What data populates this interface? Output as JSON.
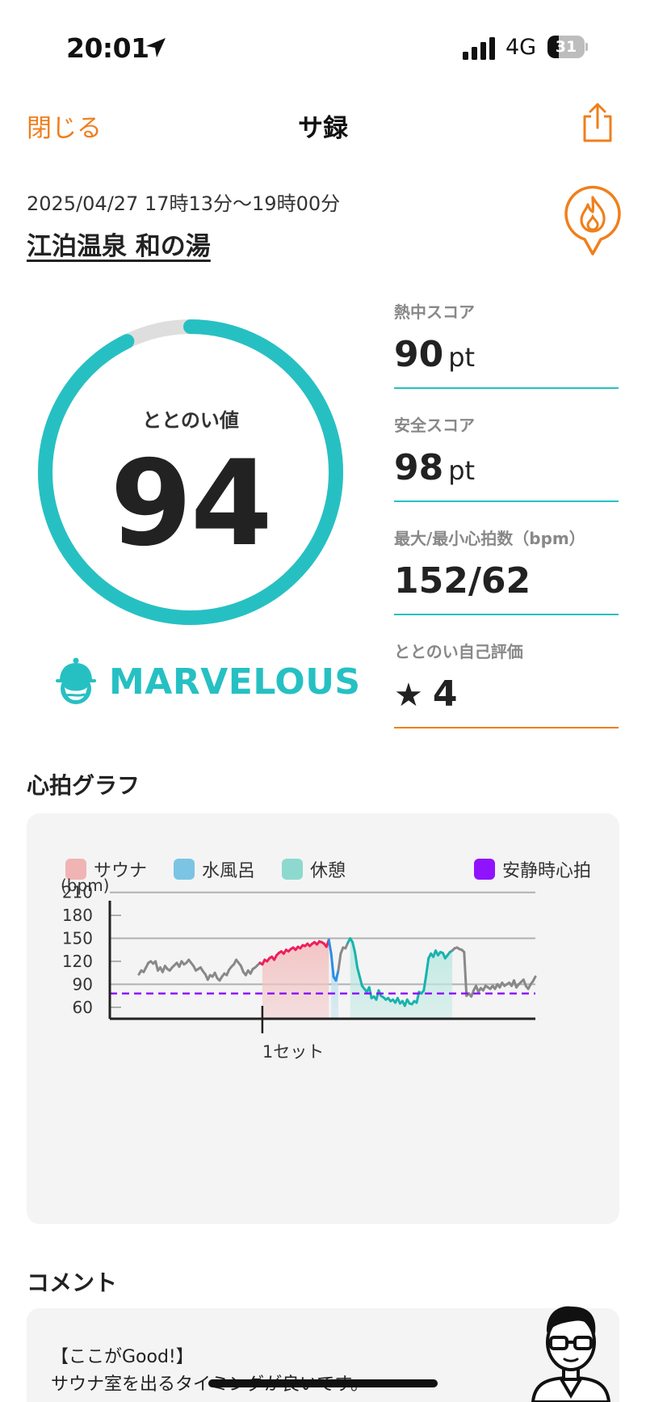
{
  "status": {
    "time": "20:01",
    "network": "4G",
    "battery": "31",
    "battery_level": 0.31
  },
  "nav": {
    "close_label": "閉じる",
    "title": "サ録"
  },
  "session": {
    "datetime": "2025/04/27 17時13分〜19時00分",
    "facility": "江泊温泉 和の湯"
  },
  "totonoi": {
    "label": "ととのい値",
    "value": "94",
    "fraction": 0.94,
    "rank": "MARVELOUS"
  },
  "stats": [
    {
      "label": "熱中スコア",
      "value": "90",
      "unit": "pt"
    },
    {
      "label": "安全スコア",
      "value": "98",
      "unit": "pt"
    },
    {
      "label": "最大/最小心拍数（bpm）",
      "value": "152/62",
      "unit": ""
    },
    {
      "label": "ととのい自己評価",
      "value": "4",
      "unit": ""
    }
  ],
  "heart_section": {
    "title": "心拍グラフ"
  },
  "chart_data": {
    "type": "line",
    "title": "",
    "xlabel": "",
    "ylabel": "(bpm)",
    "yticks": [
      210,
      180,
      150,
      120,
      90,
      60
    ],
    "ylim": [
      45,
      215
    ],
    "x_marker_label": "1セット",
    "legend": [
      {
        "name": "サウナ",
        "color": "#f0b4b4"
      },
      {
        "name": "水風呂",
        "color": "#7cc4e4"
      },
      {
        "name": "休憩",
        "color": "#8ed9cf"
      },
      {
        "name": "安静時心拍",
        "color": "#9013fe"
      }
    ],
    "resting_hr": 78,
    "colors": {
      "normal": "#888888",
      "sauna": "#ee1f5c",
      "cold": "#2a8ee6",
      "rest": "#18b3ad"
    },
    "series": [
      {
        "values": [
          103,
          108,
          106,
          112,
          118,
          120,
          117,
          120,
          108,
          112,
          106,
          114,
          110,
          108,
          112,
          115,
          118,
          113,
          120,
          116,
          118,
          122,
          118,
          114,
          108,
          110,
          112,
          107,
          103,
          96,
          102,
          100,
          105,
          98,
          95,
          100,
          104,
          102,
          109,
          113,
          116,
          122,
          118,
          114,
          106,
          102,
          108,
          104,
          110,
          112,
          115,
          118,
          116,
          122,
          120,
          124,
          126,
          122,
          128,
          131,
          133,
          130,
          135,
          133,
          136,
          138,
          135,
          139,
          137,
          141,
          140,
          143,
          140,
          143,
          145,
          142,
          146,
          145,
          143,
          139,
          148,
          130,
          100,
          95,
          108,
          130,
          138,
          137,
          144,
          150,
          145,
          132,
          112,
          100,
          88,
          84,
          80,
          86,
          72,
          74,
          70,
          82,
          75,
          73,
          70,
          72,
          68,
          70,
          66,
          72,
          65,
          68,
          62,
          70,
          65,
          64,
          68,
          66,
          80,
          78,
          82,
          102,
          124,
          130,
          126,
          134,
          128,
          132,
          131,
          124,
          128,
          132,
          134,
          137,
          138,
          136,
          135,
          132,
          75,
          78,
          74,
          82,
          88,
          80,
          85,
          82,
          88,
          86,
          84,
          88,
          84,
          90,
          86,
          92,
          88,
          90,
          92,
          88,
          95,
          86,
          90,
          93,
          96,
          88,
          84,
          90,
          94,
          100
        ],
        "phases": [
          "n",
          "n",
          "n",
          "n",
          "n",
          "n",
          "n",
          "n",
          "n",
          "n",
          "n",
          "n",
          "n",
          "n",
          "n",
          "n",
          "n",
          "n",
          "n",
          "n",
          "n",
          "n",
          "n",
          "n",
          "n",
          "n",
          "n",
          "n",
          "n",
          "n",
          "n",
          "n",
          "n",
          "n",
          "n",
          "n",
          "n",
          "n",
          "n",
          "n",
          "n",
          "n",
          "n",
          "n",
          "n",
          "n",
          "n",
          "n",
          "n",
          "n",
          "n",
          "n",
          "s",
          "s",
          "s",
          "s",
          "s",
          "s",
          "s",
          "s",
          "s",
          "s",
          "s",
          "s",
          "s",
          "s",
          "s",
          "s",
          "s",
          "s",
          "s",
          "s",
          "s",
          "s",
          "s",
          "s",
          "s",
          "s",
          "s",
          "s",
          "s",
          "c",
          "c",
          "c",
          "c",
          "n",
          "n",
          "n",
          "n",
          "r",
          "r",
          "r",
          "r",
          "r",
          "r",
          "r",
          "r",
          "r",
          "r",
          "r",
          "r",
          "r",
          "r",
          "r",
          "r",
          "r",
          "r",
          "r",
          "r",
          "r",
          "r",
          "r",
          "r",
          "r",
          "r",
          "r",
          "r",
          "r",
          "r",
          "r",
          "r",
          "r",
          "r",
          "r",
          "r",
          "r",
          "r",
          "r",
          "r",
          "r",
          "r",
          "r",
          "r",
          "n",
          "n",
          "n",
          "n",
          "n",
          "n",
          "n",
          "n",
          "n",
          "n",
          "n",
          "n",
          "n",
          "n",
          "n",
          "n",
          "n",
          "n",
          "n",
          "n",
          "n",
          "n",
          "n",
          "n",
          "n",
          "n",
          "n",
          "n",
          "n",
          "n",
          "n",
          "n",
          "n",
          "n",
          "n",
          "n"
        ]
      }
    ]
  },
  "comment_section": {
    "title": "コメント",
    "line1": "【ここがGood!】",
    "line2": "サウナ室を出るタイミングが良いです。"
  }
}
